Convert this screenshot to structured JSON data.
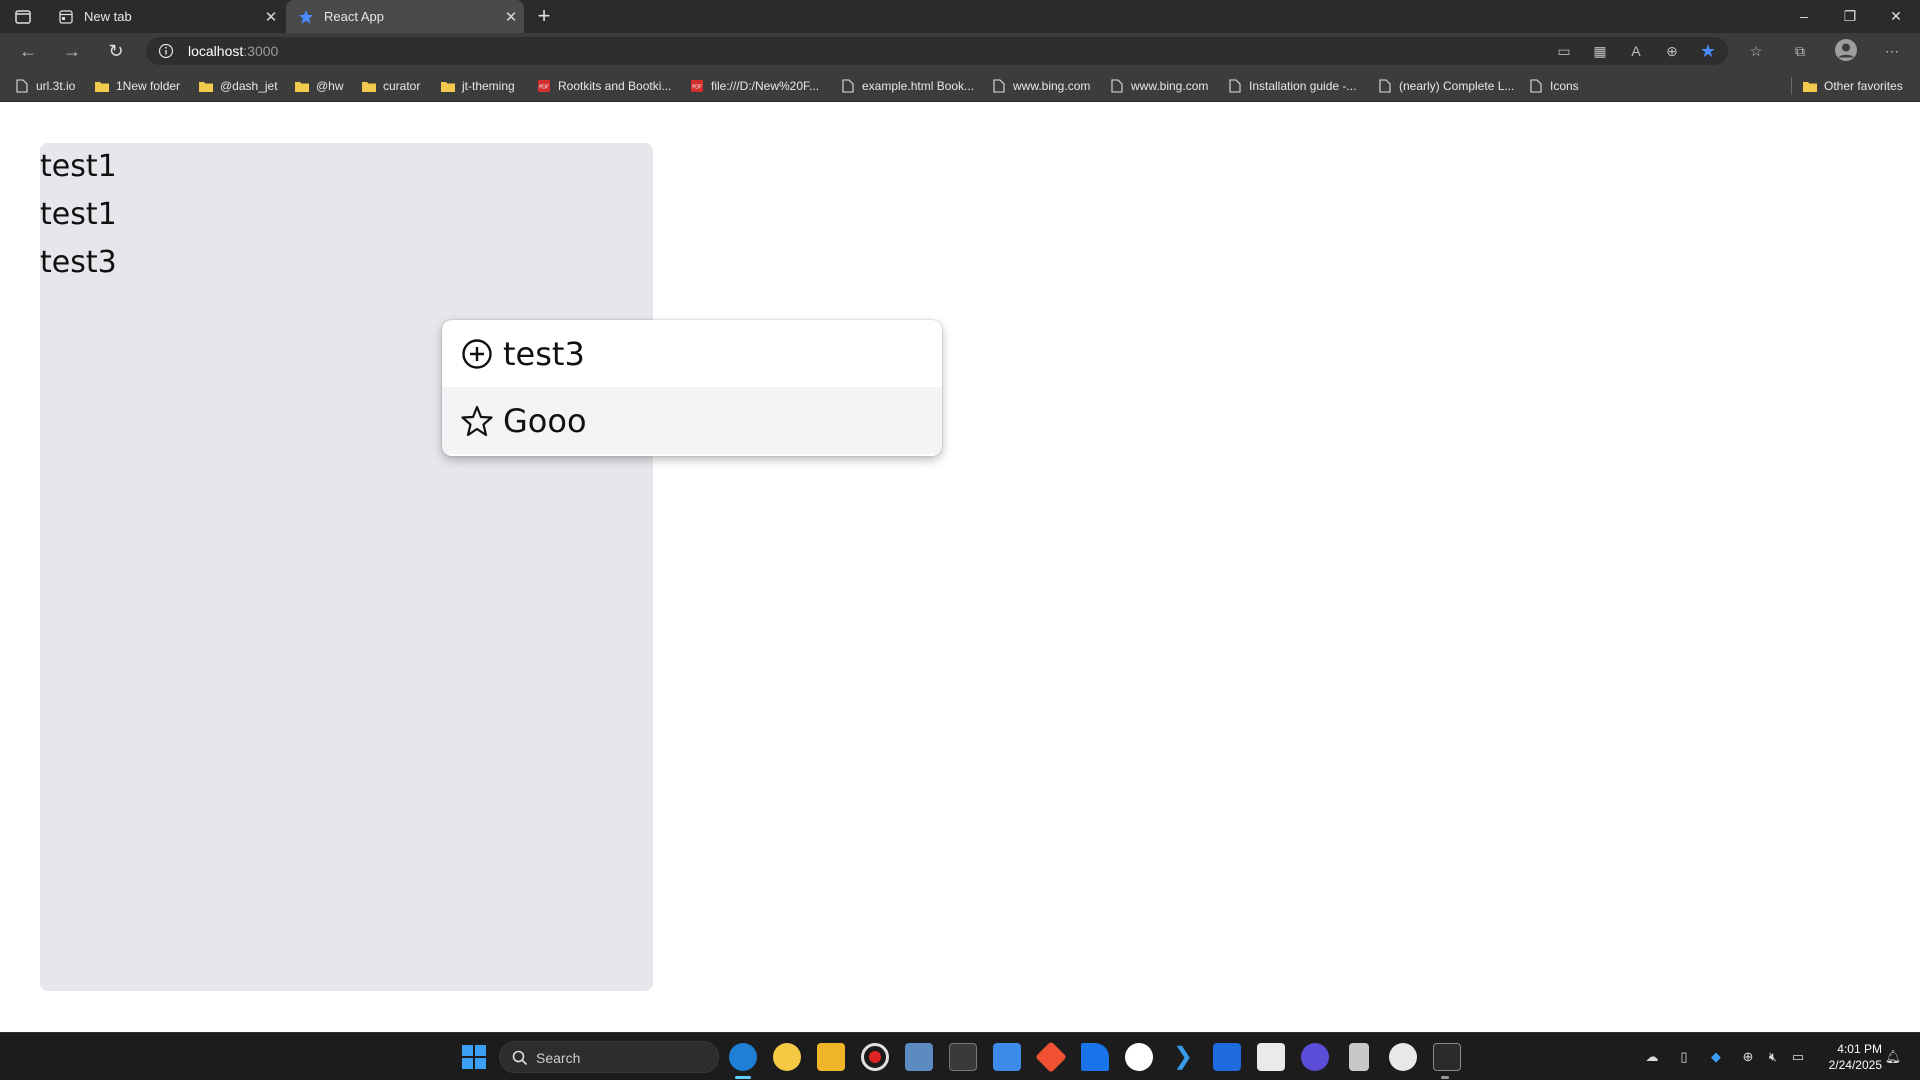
{
  "browser": {
    "tabs": [
      {
        "title": "New tab",
        "icon": "new-tab-page-icon",
        "active": false
      },
      {
        "title": "React App",
        "icon": "react-logo-icon",
        "active": true
      }
    ],
    "address": {
      "host": "localhost",
      "port": ":3000"
    },
    "bookmarks": [
      {
        "label": "url.3t.io",
        "icon": "page-icon"
      },
      {
        "label": "1New folder",
        "icon": "folder-icon"
      },
      {
        "label": "@dash_jet",
        "icon": "folder-icon"
      },
      {
        "label": "@hw",
        "icon": "folder-icon"
      },
      {
        "label": "curator",
        "icon": "folder-icon"
      },
      {
        "label": "jt-theming",
        "icon": "folder-icon"
      },
      {
        "label": "Rootkits and Bootki...",
        "icon": "pdf-icon"
      },
      {
        "label": "file:///D:/New%20F...",
        "icon": "pdf-icon"
      },
      {
        "label": "example.html Book...",
        "icon": "page-icon"
      },
      {
        "label": "www.bing.com",
        "icon": "page-icon"
      },
      {
        "label": "www.bing.com",
        "icon": "page-icon"
      },
      {
        "label": "Installation guide -...",
        "icon": "page-icon"
      },
      {
        "label": "(nearly) Complete L...",
        "icon": "page-icon"
      },
      {
        "label": "Icons",
        "icon": "page-icon"
      }
    ],
    "other_favorites": "Other favorites"
  },
  "page": {
    "panel_items": [
      "test1",
      "test1",
      "test3"
    ],
    "menu": [
      {
        "label": "test3",
        "icon": "plus-circle-icon",
        "highlighted": false
      },
      {
        "label": "Gooo",
        "icon": "star-icon",
        "highlighted": true
      }
    ]
  },
  "taskbar": {
    "search_placeholder": "Search",
    "time": "4:01 PM",
    "date": "2/24/2025"
  },
  "colors": {
    "panel_bg": "#e5e7eb",
    "menu_hover": "#f3f4f6",
    "favorite_star": "#4a8cff"
  }
}
